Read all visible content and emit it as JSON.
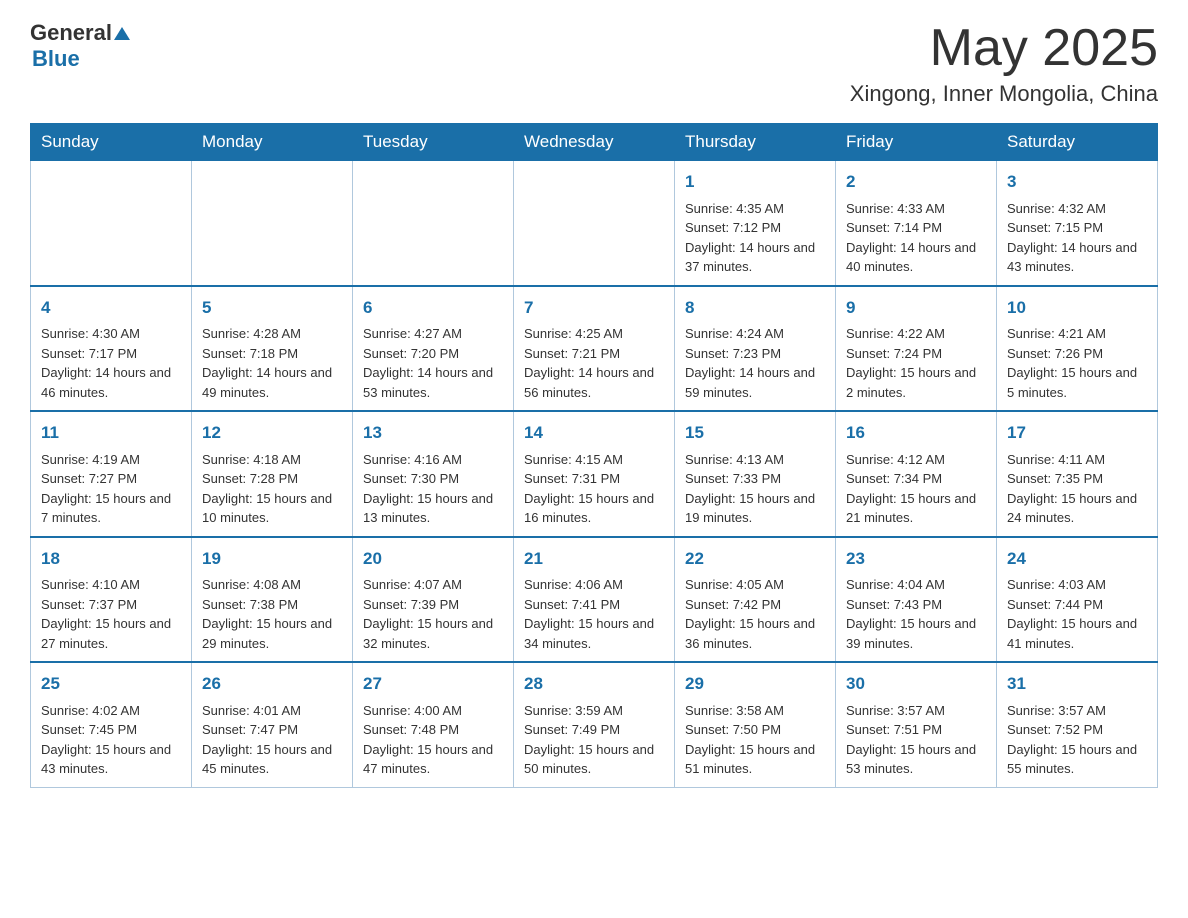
{
  "header": {
    "logo_general": "General",
    "logo_blue": "Blue",
    "month_title": "May 2025",
    "location": "Xingong, Inner Mongolia, China"
  },
  "days_of_week": [
    "Sunday",
    "Monday",
    "Tuesday",
    "Wednesday",
    "Thursday",
    "Friday",
    "Saturday"
  ],
  "weeks": [
    {
      "days": [
        {
          "number": "",
          "info": ""
        },
        {
          "number": "",
          "info": ""
        },
        {
          "number": "",
          "info": ""
        },
        {
          "number": "",
          "info": ""
        },
        {
          "number": "1",
          "info": "Sunrise: 4:35 AM\nSunset: 7:12 PM\nDaylight: 14 hours and 37 minutes."
        },
        {
          "number": "2",
          "info": "Sunrise: 4:33 AM\nSunset: 7:14 PM\nDaylight: 14 hours and 40 minutes."
        },
        {
          "number": "3",
          "info": "Sunrise: 4:32 AM\nSunset: 7:15 PM\nDaylight: 14 hours and 43 minutes."
        }
      ]
    },
    {
      "days": [
        {
          "number": "4",
          "info": "Sunrise: 4:30 AM\nSunset: 7:17 PM\nDaylight: 14 hours and 46 minutes."
        },
        {
          "number": "5",
          "info": "Sunrise: 4:28 AM\nSunset: 7:18 PM\nDaylight: 14 hours and 49 minutes."
        },
        {
          "number": "6",
          "info": "Sunrise: 4:27 AM\nSunset: 7:20 PM\nDaylight: 14 hours and 53 minutes."
        },
        {
          "number": "7",
          "info": "Sunrise: 4:25 AM\nSunset: 7:21 PM\nDaylight: 14 hours and 56 minutes."
        },
        {
          "number": "8",
          "info": "Sunrise: 4:24 AM\nSunset: 7:23 PM\nDaylight: 14 hours and 59 minutes."
        },
        {
          "number": "9",
          "info": "Sunrise: 4:22 AM\nSunset: 7:24 PM\nDaylight: 15 hours and 2 minutes."
        },
        {
          "number": "10",
          "info": "Sunrise: 4:21 AM\nSunset: 7:26 PM\nDaylight: 15 hours and 5 minutes."
        }
      ]
    },
    {
      "days": [
        {
          "number": "11",
          "info": "Sunrise: 4:19 AM\nSunset: 7:27 PM\nDaylight: 15 hours and 7 minutes."
        },
        {
          "number": "12",
          "info": "Sunrise: 4:18 AM\nSunset: 7:28 PM\nDaylight: 15 hours and 10 minutes."
        },
        {
          "number": "13",
          "info": "Sunrise: 4:16 AM\nSunset: 7:30 PM\nDaylight: 15 hours and 13 minutes."
        },
        {
          "number": "14",
          "info": "Sunrise: 4:15 AM\nSunset: 7:31 PM\nDaylight: 15 hours and 16 minutes."
        },
        {
          "number": "15",
          "info": "Sunrise: 4:13 AM\nSunset: 7:33 PM\nDaylight: 15 hours and 19 minutes."
        },
        {
          "number": "16",
          "info": "Sunrise: 4:12 AM\nSunset: 7:34 PM\nDaylight: 15 hours and 21 minutes."
        },
        {
          "number": "17",
          "info": "Sunrise: 4:11 AM\nSunset: 7:35 PM\nDaylight: 15 hours and 24 minutes."
        }
      ]
    },
    {
      "days": [
        {
          "number": "18",
          "info": "Sunrise: 4:10 AM\nSunset: 7:37 PM\nDaylight: 15 hours and 27 minutes."
        },
        {
          "number": "19",
          "info": "Sunrise: 4:08 AM\nSunset: 7:38 PM\nDaylight: 15 hours and 29 minutes."
        },
        {
          "number": "20",
          "info": "Sunrise: 4:07 AM\nSunset: 7:39 PM\nDaylight: 15 hours and 32 minutes."
        },
        {
          "number": "21",
          "info": "Sunrise: 4:06 AM\nSunset: 7:41 PM\nDaylight: 15 hours and 34 minutes."
        },
        {
          "number": "22",
          "info": "Sunrise: 4:05 AM\nSunset: 7:42 PM\nDaylight: 15 hours and 36 minutes."
        },
        {
          "number": "23",
          "info": "Sunrise: 4:04 AM\nSunset: 7:43 PM\nDaylight: 15 hours and 39 minutes."
        },
        {
          "number": "24",
          "info": "Sunrise: 4:03 AM\nSunset: 7:44 PM\nDaylight: 15 hours and 41 minutes."
        }
      ]
    },
    {
      "days": [
        {
          "number": "25",
          "info": "Sunrise: 4:02 AM\nSunset: 7:45 PM\nDaylight: 15 hours and 43 minutes."
        },
        {
          "number": "26",
          "info": "Sunrise: 4:01 AM\nSunset: 7:47 PM\nDaylight: 15 hours and 45 minutes."
        },
        {
          "number": "27",
          "info": "Sunrise: 4:00 AM\nSunset: 7:48 PM\nDaylight: 15 hours and 47 minutes."
        },
        {
          "number": "28",
          "info": "Sunrise: 3:59 AM\nSunset: 7:49 PM\nDaylight: 15 hours and 50 minutes."
        },
        {
          "number": "29",
          "info": "Sunrise: 3:58 AM\nSunset: 7:50 PM\nDaylight: 15 hours and 51 minutes."
        },
        {
          "number": "30",
          "info": "Sunrise: 3:57 AM\nSunset: 7:51 PM\nDaylight: 15 hours and 53 minutes."
        },
        {
          "number": "31",
          "info": "Sunrise: 3:57 AM\nSunset: 7:52 PM\nDaylight: 15 hours and 55 minutes."
        }
      ]
    }
  ]
}
